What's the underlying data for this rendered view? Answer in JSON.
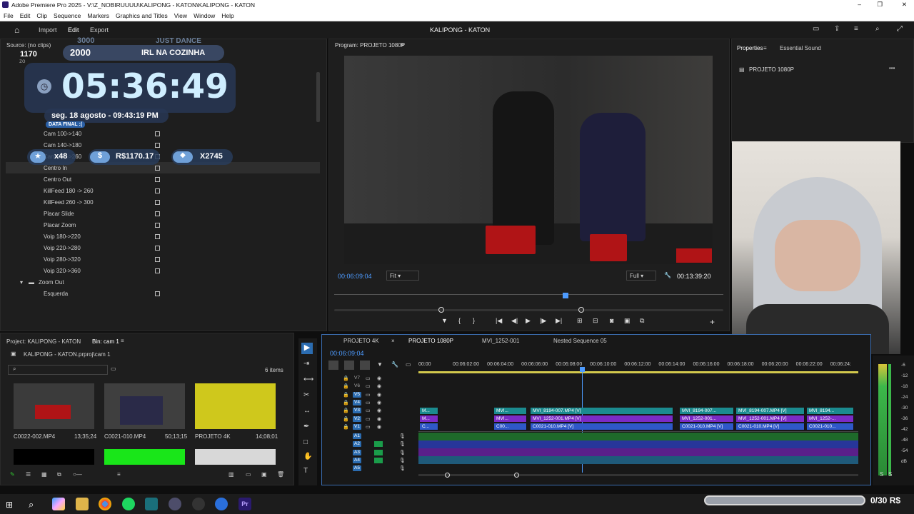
{
  "window": {
    "title": "Adobe Premiere Pro 2025 - V:\\Z_NOBIRUUUU\\KALIPONG - KATON\\KALIPONG - KATON"
  },
  "menu": [
    "File",
    "Edit",
    "Clip",
    "Sequence",
    "Markers",
    "Graphics and Titles",
    "View",
    "Window",
    "Help"
  ],
  "header": {
    "tabs": [
      "Import",
      "Edit",
      "Export"
    ],
    "project_title": "KALIPONG - KATON"
  },
  "source": {
    "label": "Source: (no clips)",
    "search_value": "zo"
  },
  "overlay": {
    "counter_top": "3000",
    "just_dance": "JUST DANCE",
    "small_left": "1170",
    "count": "2000",
    "irl": "IRL NA COZINHA",
    "clock": "05:36:49",
    "date": "seg. 18 agosto - 09:43:19 PM",
    "data_final": "DATA FINAL :(",
    "stars": "x48",
    "money": "R$1170.17",
    "drops": "X2745"
  },
  "effects_tree": {
    "items": [
      {
        "label": "Cam 100->140",
        "type": "item"
      },
      {
        "label": "Cam 140->180",
        "type": "item"
      },
      {
        "label": "Cam 220->260",
        "type": "item"
      },
      {
        "label": "Centro In",
        "type": "item",
        "selected": true
      },
      {
        "label": "Centro Out",
        "type": "item"
      },
      {
        "label": "KillFeed 180 -> 260",
        "type": "item"
      },
      {
        "label": "KillFeed 260 -> 300",
        "type": "item"
      },
      {
        "label": "Placar Slide",
        "type": "item"
      },
      {
        "label": "Placar Zoom",
        "type": "item"
      },
      {
        "label": "Voip 180->220",
        "type": "item"
      },
      {
        "label": "Voip 220->280",
        "type": "item"
      },
      {
        "label": "Voip 280->320",
        "type": "item"
      },
      {
        "label": "Voip 320->360",
        "type": "item"
      },
      {
        "label": "Zoom Out",
        "type": "folder"
      },
      {
        "label": "Esquerda",
        "type": "item"
      }
    ]
  },
  "program": {
    "label": "Program: PROJETO 1080P",
    "timecode": "00:06:09:04",
    "fit": "Fit",
    "quality": "Full",
    "duration": "00:13:39:20"
  },
  "properties": {
    "tab1": "Properties",
    "tab2": "Essential Sound",
    "item": "PROJETO 1080P"
  },
  "project": {
    "label": "Project: KALIPONG - KATON",
    "bin": "Bin: cam 1",
    "path": "KALIPONG - KATON.prproj\\cam 1",
    "items_count": "6 items",
    "clips": [
      {
        "name": "C0022-002.MP4",
        "duration": "13;35;24"
      },
      {
        "name": "C0021-010.MP4",
        "duration": "50;13;15"
      },
      {
        "name": "PROJETO 4K",
        "duration": "14;08;01"
      }
    ]
  },
  "timeline": {
    "tabs": [
      "PROJETO 4K",
      "PROJETO 1080P",
      "MVI_1252-001",
      "Nested Sequence 05"
    ],
    "timecode": "00:06:09:04",
    "ruler": [
      "00:00",
      "00:06:02:00",
      "00:06:04:00",
      "00:06:06:00",
      "00:06:08:00",
      "00:06:10:00",
      "00:06:12:00",
      "00:06:14:00",
      "00:06:16:00",
      "00:06:18:00",
      "00:06:20:00",
      "00:06:22:00",
      "00:06:24:"
    ],
    "video_tracks": [
      "V7",
      "V6",
      "V5",
      "V4",
      "V3",
      "V2",
      "V1"
    ],
    "audio_tracks": [
      "A1",
      "A2",
      "A3",
      "A4",
      "A5"
    ],
    "v3_clips": [
      "M...",
      "MVI...",
      "MVI_8194-007.MP4 [V]",
      "MVI_8194-007...",
      "MVI_8194-007.MP4 [V]",
      "MVI_8194..."
    ],
    "v2_clips": [
      "M...",
      "MVI...",
      "MVI_1252-001.MP4 [V]",
      "MVI_1252-001...",
      "MVI_1252-001.MP4 [V]",
      "MVI_1252-..."
    ],
    "v1_clips": [
      "C...",
      "C00...",
      "C0021-010.MP4 [V]",
      "C0021-010.MP4 [V]",
      "C0021-010.MP4 [V]",
      "C0021-010..."
    ]
  },
  "meter": {
    "labels": [
      "-6",
      "-12",
      "-18",
      "-24",
      "-30",
      "-36",
      "-42",
      "-48",
      "-54",
      "dB"
    ],
    "s": "S"
  },
  "goal": {
    "text": "0/30 R$"
  }
}
